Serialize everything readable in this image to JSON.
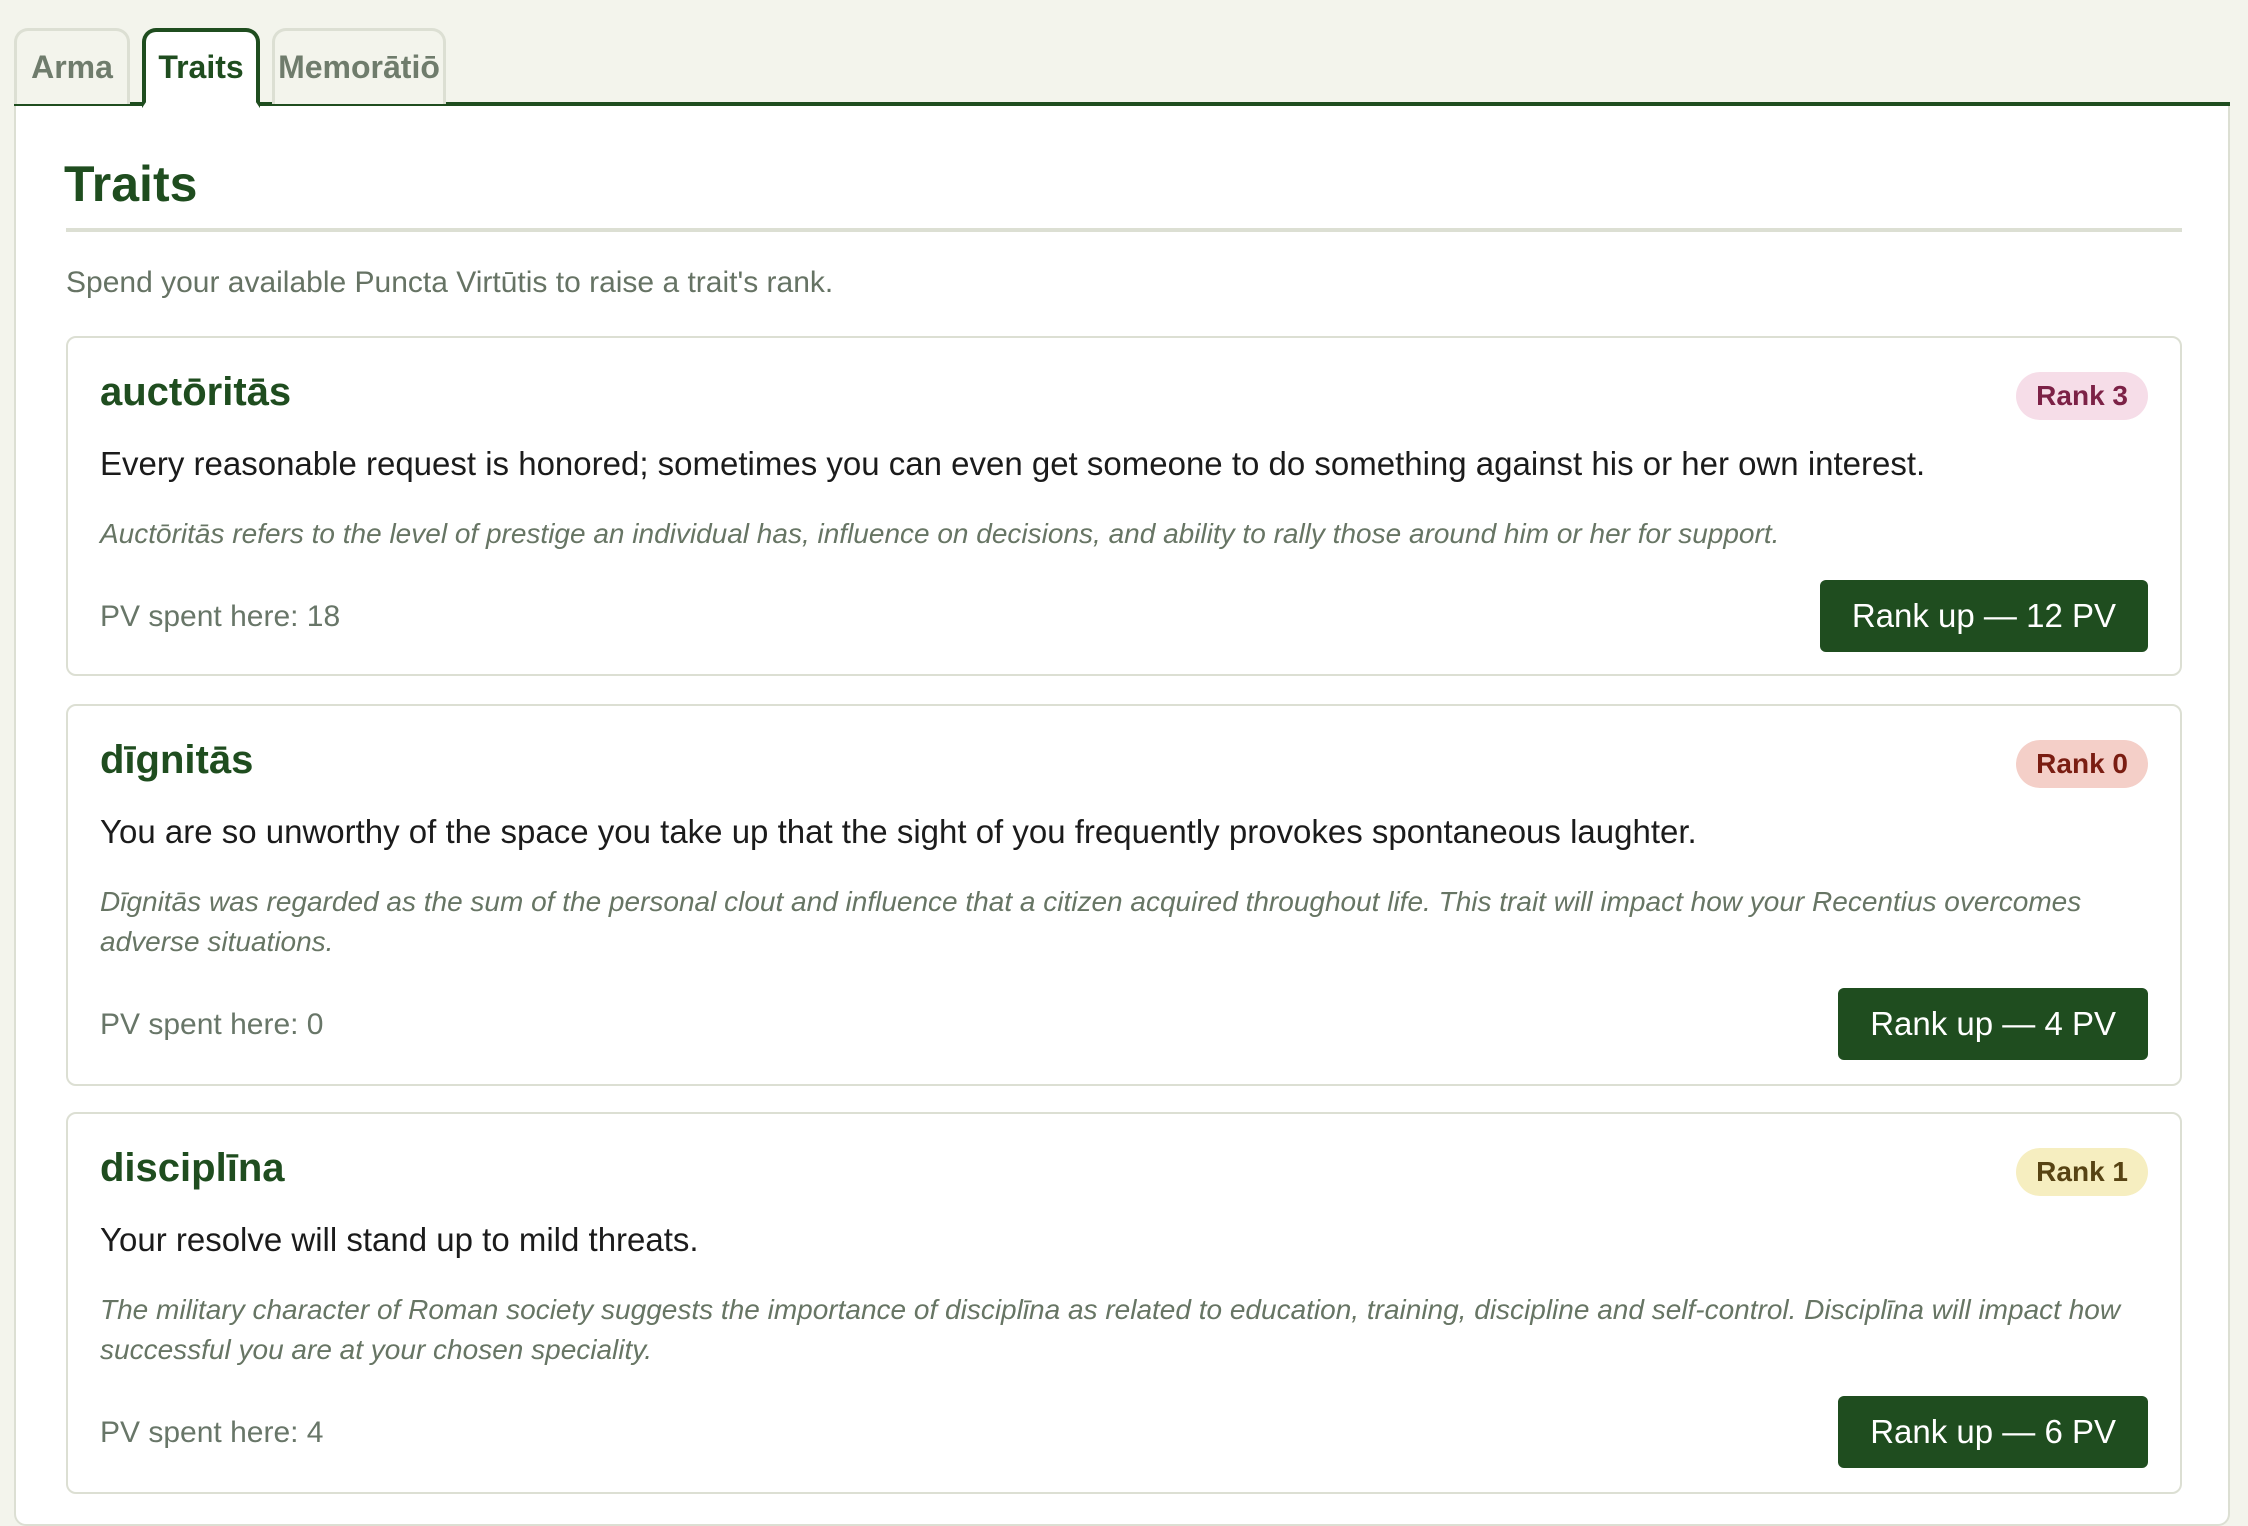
{
  "tabs": [
    {
      "label": "Arma"
    },
    {
      "label": "Traits"
    },
    {
      "label": "Memorātiō"
    }
  ],
  "section": {
    "title": "Traits",
    "intro": "Spend your available Puncta Virtūtis to raise a trait's rank."
  },
  "traits": [
    {
      "name": "auctōritās",
      "rank": "Rank 3",
      "effect": "Every reasonable request is honored; sometimes you can even get someone to do something against his or her own interest.",
      "lore": "Auctōritās refers to the level of prestige an individual has, influence on decisions, and ability to rally those around him or her for support.",
      "pv_spent": "PV spent here: 18",
      "button": "Rank up — 12 PV"
    },
    {
      "name": "dīgnitās",
      "rank": "Rank 0",
      "effect": "You are so unworthy of the space you take up that the sight of you frequently provokes spontaneous laughter.",
      "lore": "Dīgnitās was regarded as the sum of the personal clout and influence that a citizen acquired throughout life. This trait will impact how your Recentius overcomes adverse situations.",
      "pv_spent": "PV spent here: 0",
      "button": "Rank up — 4 PV"
    },
    {
      "name": "disciplīna",
      "rank": "Rank 1",
      "effect": "Your resolve will stand up to mild threats.",
      "lore": "The military character of Roman society suggests the importance of disciplīna as related to education, training, discipline and self-control. Disciplīna will impact how successful you are at your chosen speciality.",
      "pv_spent": "PV spent here: 4",
      "button": "Rank up — 6 PV"
    }
  ],
  "colors": {
    "primary": "#1f4d1f",
    "rank_3_bg": "#f6dde8",
    "rank_3_text": "#7c2146",
    "rank_0_bg": "#f4cfc8",
    "rank_0_text": "#7a1d12",
    "rank_1_bg": "#f6eec0",
    "rank_1_text": "#574313"
  }
}
